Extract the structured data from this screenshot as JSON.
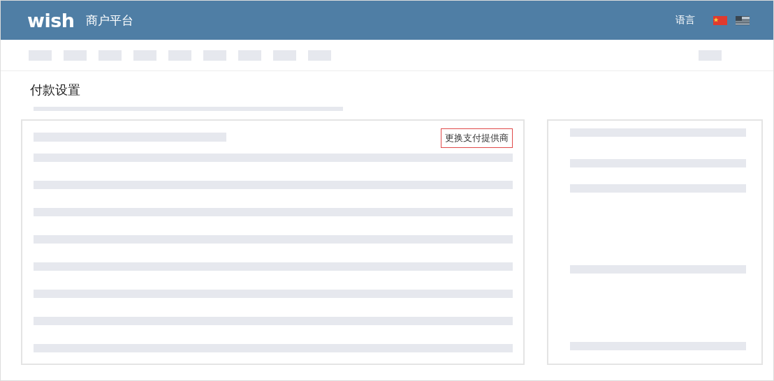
{
  "header": {
    "logo": "wish",
    "platform": "商户平台",
    "language_label": "语言",
    "languages": [
      {
        "kind": "cn",
        "selected": true
      },
      {
        "kind": "us",
        "selected": false
      }
    ]
  },
  "page_title": "付款设置",
  "main_card": {
    "button": "更换支付提供商"
  }
}
